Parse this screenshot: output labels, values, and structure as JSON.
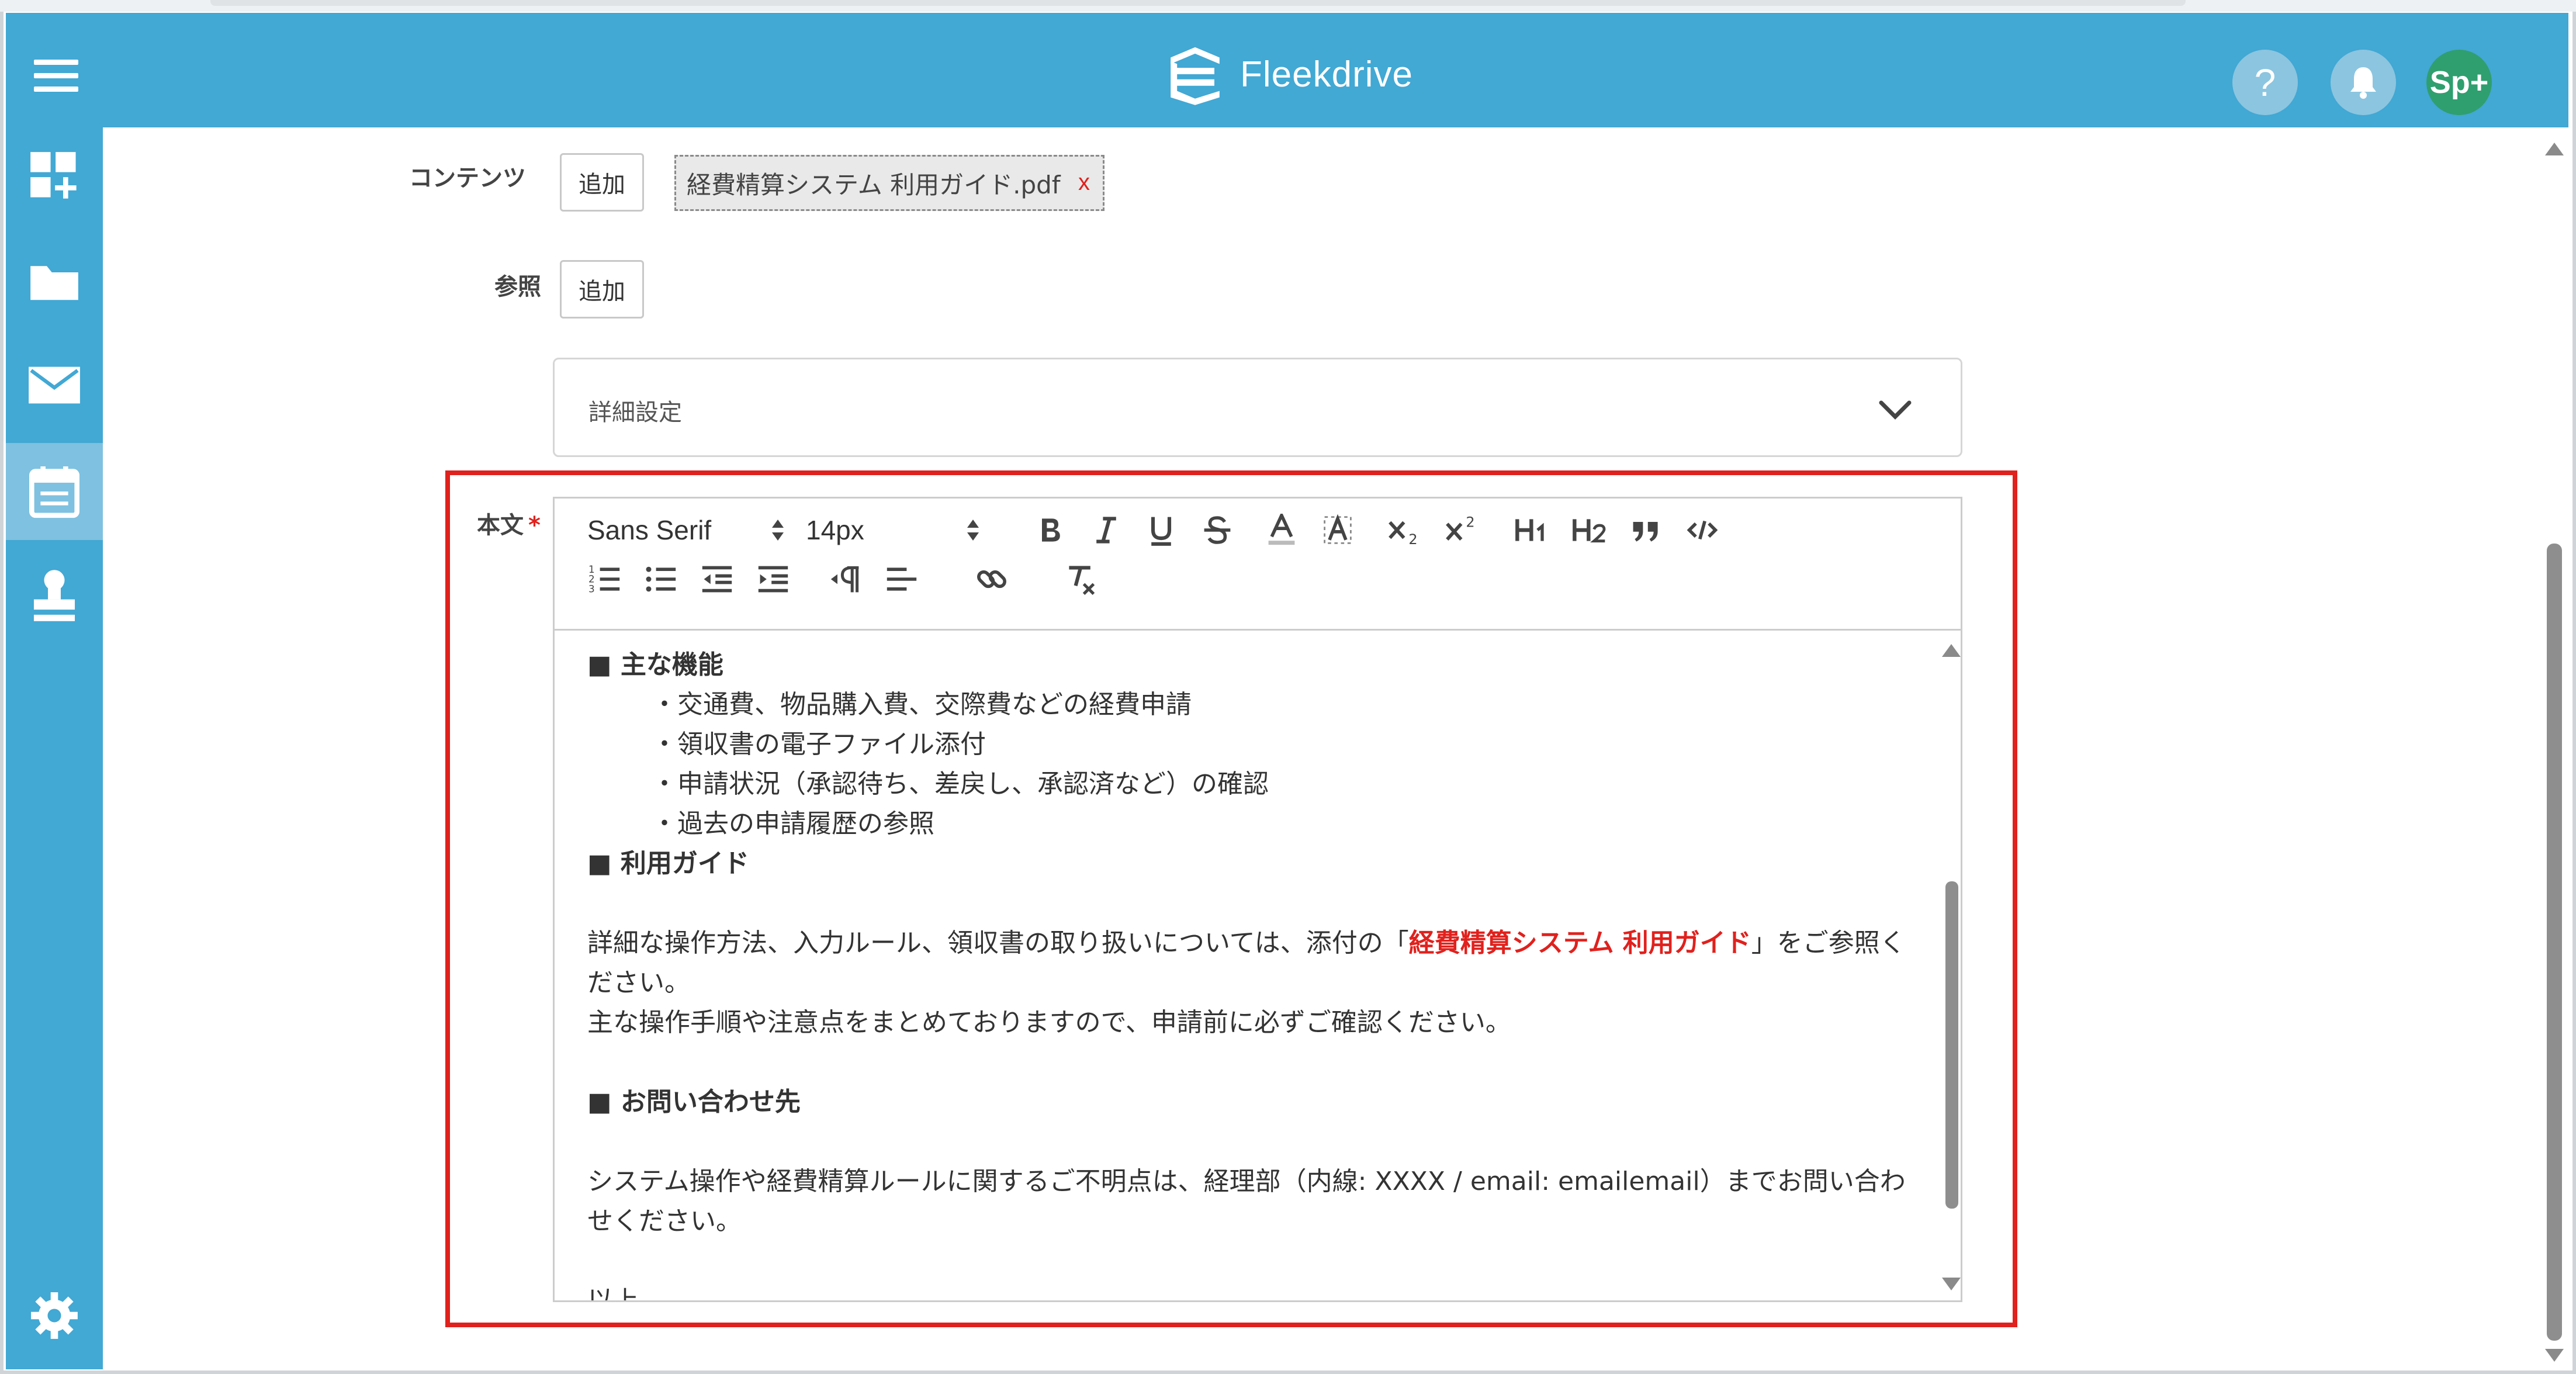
{
  "app": {
    "name": "Fleekdrive"
  },
  "header": {
    "menu_icon": "hamburger-icon",
    "help_label": "?",
    "bell_icon": "bell-icon",
    "avatar_label": "Sp+",
    "accent_color": "#42a8d4",
    "avatar_color": "#2f9f6f"
  },
  "sidebar": {
    "items": [
      {
        "icon": "dashboard-add-icon"
      },
      {
        "icon": "folder-icon"
      },
      {
        "icon": "mail-icon"
      },
      {
        "icon": "calendar-icon",
        "active": true
      },
      {
        "icon": "stamp-icon"
      }
    ],
    "settings_icon": "gear-icon"
  },
  "form": {
    "contents_label": "コンテンツ",
    "contents_add": "追加",
    "attached_file": "経費精算システム 利用ガイド.pdf",
    "remove_file": "x",
    "reference_label": "参照",
    "reference_add": "追加",
    "details_label": "詳細設定",
    "body_label": "本文",
    "required_mark": "*"
  },
  "toolbar": {
    "font_family": "Sans Serif",
    "font_size": "14px",
    "buttons_row1": [
      "bold",
      "italic",
      "underline",
      "strike",
      "text-color",
      "background-color",
      "subscript",
      "superscript",
      "h1",
      "h2",
      "blockquote",
      "code"
    ],
    "buttons_row2": [
      "ordered-list",
      "bullet-list",
      "outdent",
      "indent",
      "rtl-direction",
      "align",
      "link",
      "clear-format"
    ]
  },
  "body": {
    "s1_heading": "主な機能",
    "s1_items": [
      "・交通費、物品購入費、交際費などの経費申請",
      "・領収書の電子ファイル添付",
      "・申請状況（承認待ち、差戻し、承認済など）の確認",
      "・過去の申請履歴の参照"
    ],
    "s2_heading": "利用ガイド",
    "s2_text1_before": "詳細な操作方法、入力ルール、領収書の取り扱いについては、添付の「",
    "s2_text1_highlight": "経費精算システム 利用ガイド",
    "s2_text1_after": "」をご参照ください。",
    "s2_text2": "主な操作手順や注意点をまとめておりますので、申請前に必ずご確認ください。",
    "s3_heading": "お問い合わせ先",
    "s3_text": "システム操作や経費精算ルールに関するご不明点は、経理部（内線: XXXX / email: emailemail）までお問い合わせください。",
    "closing": "以上",
    "bullet_mark": "■"
  },
  "colors": {
    "highlight_border": "#e0211d",
    "link_red": "#e0211d"
  }
}
